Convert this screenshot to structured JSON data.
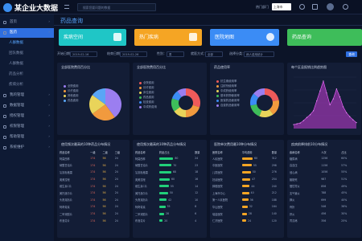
{
  "topbar": {
    "logo": "某企业大数据",
    "search_placeholder": "搜索您要问题的数据",
    "dept_label": "热门部门",
    "dept_value": "上海市"
  },
  "sidebar": {
    "items": [
      {
        "label": "首页",
        "kind": "top"
      },
      {
        "label": "医药",
        "kind": "top",
        "active": true
      },
      {
        "label": "人群数据",
        "kind": "sub",
        "current": true
      },
      {
        "label": "团队数据",
        "kind": "sub"
      },
      {
        "label": "人群数据",
        "kind": "sub"
      },
      {
        "label": "药品分析",
        "kind": "sub"
      },
      {
        "label": "疾病分析",
        "kind": "sub"
      },
      {
        "label": "我的管理",
        "kind": "top"
      },
      {
        "label": "数据管理",
        "kind": "top"
      },
      {
        "label": "授权管理",
        "kind": "top"
      },
      {
        "label": "权限管理",
        "kind": "top"
      },
      {
        "label": "帮助管理",
        "kind": "top"
      },
      {
        "label": "系统维护",
        "kind": "top"
      }
    ]
  },
  "page_title": "药品查询",
  "cards": [
    {
      "label": "疾病空间",
      "color": "#1fc6c6"
    },
    {
      "label": "热门疾病",
      "color": "#f5a524"
    },
    {
      "label": "医院地图",
      "color": "#3b8cf5"
    },
    {
      "label": "药品查询",
      "color": "#3ebd5a"
    }
  ],
  "filters": {
    "start_label": "开始日期：",
    "start_value": "2019-02-16",
    "end_label": "结束日期：",
    "end_value": "2019-02-26",
    "type_label": "性别：",
    "type_value": "男",
    "region_label": "就医方式：",
    "region_value": "全部",
    "select_label": "选择分类：",
    "select_value": "病人费用统计",
    "query": "查询"
  },
  "row1": {
    "p1": {
      "title": "全部医院费用百分比",
      "legend": [
        "全院费用",
        "诊疗费用",
        "其他费用",
        "药品费用"
      ],
      "chart_data": {
        "type": "pie",
        "labels": [
          "全院费用",
          "诊疗费用",
          "其他费用",
          "药品费用"
        ],
        "values": [
          40,
          25,
          20,
          15
        ],
        "colors": [
          "#9b7ef0",
          "#f19a3e",
          "#e9d45a",
          "#5aa6f6"
        ]
      }
    },
    "p2": {
      "title": "全部医院费用百分比",
      "legend": [
        "全院费用",
        "诊疗费用",
        "床位费用",
        "药品费用",
        "检查费用",
        "中成药费用"
      ],
      "chart_data": {
        "type": "pie",
        "labels": [
          "全院费用",
          "诊疗费用",
          "床位费用",
          "药品费用",
          "检查费用",
          "中成药费用"
        ],
        "values": [
          30,
          20,
          15,
          15,
          10,
          10
        ],
        "colors": [
          "#ee5a5a",
          "#f19a3e",
          "#e9d45a",
          "#3ebd5a",
          "#3b8cf5",
          "#9b7ef0"
        ]
      }
    },
    "p3": {
      "title": "药品使用率",
      "legend": [
        "抗生素使用率",
        "注射剂使用率",
        "中成药使用率",
        "基本药物使用率",
        "医保药品使用率",
        "自费药品使用率"
      ],
      "chart_data": {
        "type": "pie",
        "labels": [
          "抗生素使用率",
          "注射剂使用率",
          "中成药使用率",
          "基本药物使用率",
          "医保药品使用率",
          "自费药品使用率"
        ],
        "values": [
          22,
          18,
          16,
          16,
          14,
          14
        ],
        "colors": [
          "#ee5a5a",
          "#f19a3e",
          "#e9d45a",
          "#3ebd5a",
          "#3b8cf5",
          "#9b7ef0"
        ]
      }
    },
    "p4": {
      "title": "每个区县报销比例趋势图",
      "chart_data": {
        "type": "area",
        "x": [
          1,
          2,
          3,
          4,
          5,
          6,
          7,
          8,
          9,
          10,
          11,
          12,
          13,
          14,
          15,
          16,
          17,
          18,
          19,
          20
        ],
        "values": [
          10,
          12,
          14,
          20,
          28,
          35,
          45,
          70,
          95,
          120,
          90,
          60,
          75,
          100,
          80,
          55,
          40,
          30,
          22,
          15
        ],
        "ylim": [
          0,
          130
        ],
        "color": "#c43ed6"
      }
    }
  },
  "row2": {
    "t1": {
      "title": "使用频次最高的10种药品分布情况",
      "cols": [
        "药品名称",
        "一级",
        "二级",
        "三级"
      ],
      "rows": [
        [
          "阿莫西林",
          "174",
          "56",
          "24"
        ],
        [
          "硝酸甘油片",
          "174",
          "56",
          "24"
        ],
        [
          "氢氯吡格雷",
          "174",
          "56",
          "24"
        ],
        [
          "奥美拉唑",
          "174",
          "56",
          "24"
        ],
        [
          "维生素C片",
          "174",
          "56",
          "24"
        ],
        [
          "美托洛尔片",
          "174",
          "56",
          "24"
        ],
        [
          "头孢克肟片",
          "174",
          "56",
          "24"
        ],
        [
          "阿奇霉素",
          "174",
          "56",
          "24"
        ],
        [
          "二甲双胍片",
          "174",
          "56",
          "24"
        ],
        [
          "布洛芬片",
          "174",
          "56",
          "24"
        ]
      ]
    },
    "t2": {
      "title": "使用频次最高的10种药品分布情况",
      "cols": [
        "药品名称",
        "药品占比",
        "数量"
      ],
      "rows": [
        [
          "阿莫西林",
          "80",
          "24"
        ],
        [
          "硝酸甘油片",
          "70",
          "23"
        ],
        [
          "氢氯吡格雷",
          "68",
          "18"
        ],
        [
          "奥美拉唑",
          "60",
          "16"
        ],
        [
          "维生素C片",
          "55",
          "14"
        ],
        [
          "美托洛尔片",
          "50",
          "12"
        ],
        [
          "头孢克肟片",
          "42",
          "10"
        ],
        [
          "阿奇霉素",
          "35",
          "8"
        ],
        [
          "二甲双胍片",
          "28",
          "6"
        ],
        [
          "布洛芬片",
          "20",
          "4"
        ]
      ]
    },
    "t3": {
      "title": "医院单次费用最10种分布情况",
      "cols": [
        "医院名称",
        "平均费用",
        "数量"
      ],
      "rows": [
        [
          "人民医院",
          "60",
          "312"
        ],
        [
          "中医医院",
          "55",
          "298"
        ],
        [
          "儿童医院",
          "50",
          "276"
        ],
        [
          "妇幼医院",
          "47",
          "254"
        ],
        [
          "肿瘤医院",
          "44",
          "240"
        ],
        [
          "上海市中心",
          "40",
          "212"
        ],
        [
          "第一人民医院",
          "36",
          "188"
        ],
        [
          "华山医院",
          "32",
          "164"
        ],
        [
          "瑞金医院",
          "28",
          "140"
        ],
        [
          "仁济医院",
          "24",
          "120"
        ]
      ]
    },
    "t4": {
      "title": "疾病前降排前10分布情况",
      "cols": [
        "疾病名称",
        "人次",
        "占比"
      ],
      "rows": [
        [
          "糖尿病",
          "1256",
          "60%"
        ],
        [
          "高血压",
          "1156",
          "57%"
        ],
        [
          "冠心病",
          "1056",
          "55%"
        ],
        [
          "脑梗死",
          "987",
          "51%"
        ],
        [
          "慢性胃炎",
          "856",
          "49%"
        ],
        [
          "支气管炎",
          "788",
          "45%"
        ],
        [
          "肺炎",
          "699",
          "40%"
        ],
        [
          "骨折",
          "546",
          "36%"
        ],
        [
          "肝炎",
          "456",
          "30%"
        ],
        [
          "胃溃疡",
          "356",
          "25%"
        ]
      ]
    }
  }
}
